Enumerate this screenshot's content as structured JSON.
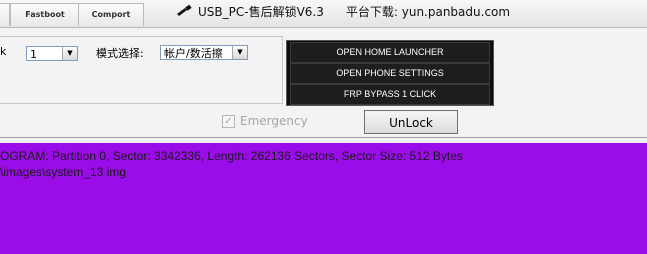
{
  "window": {
    "title": "USB_PC-售后解锁V6.3",
    "download_text": "平台下载: yun.panbadu.com"
  },
  "tabs": [
    {
      "label": ""
    },
    {
      "label": "Fastboot"
    },
    {
      "label": "Comport"
    }
  ],
  "settings": {
    "colon_fragment": "k",
    "number_select_value": "1",
    "mode_label": "模式选择:",
    "mode_select_value": "帐户/数活擦"
  },
  "actions": {
    "open_home_launcher": "OPEN HOME LAUNCHER",
    "open_phone_settings": "OPEN PHONE SETTINGS",
    "frp_bypass": "FRP BYPASS 1 CLICK"
  },
  "emergency": {
    "label": "Emergency",
    "checked_mark": "✓"
  },
  "unlock_label": "UnLock",
  "log": {
    "lines": [
      "OGRAM: Partition 0, Sector: 3342336, Length: 262136 Sectors, Sector Size: 512 Bytes",
      "\\images\\system_13 img"
    ],
    "background": "#9b0de8"
  },
  "icons": {
    "title_icon": "usb-plug-icon",
    "dropdown": "chevron-down-icon"
  }
}
